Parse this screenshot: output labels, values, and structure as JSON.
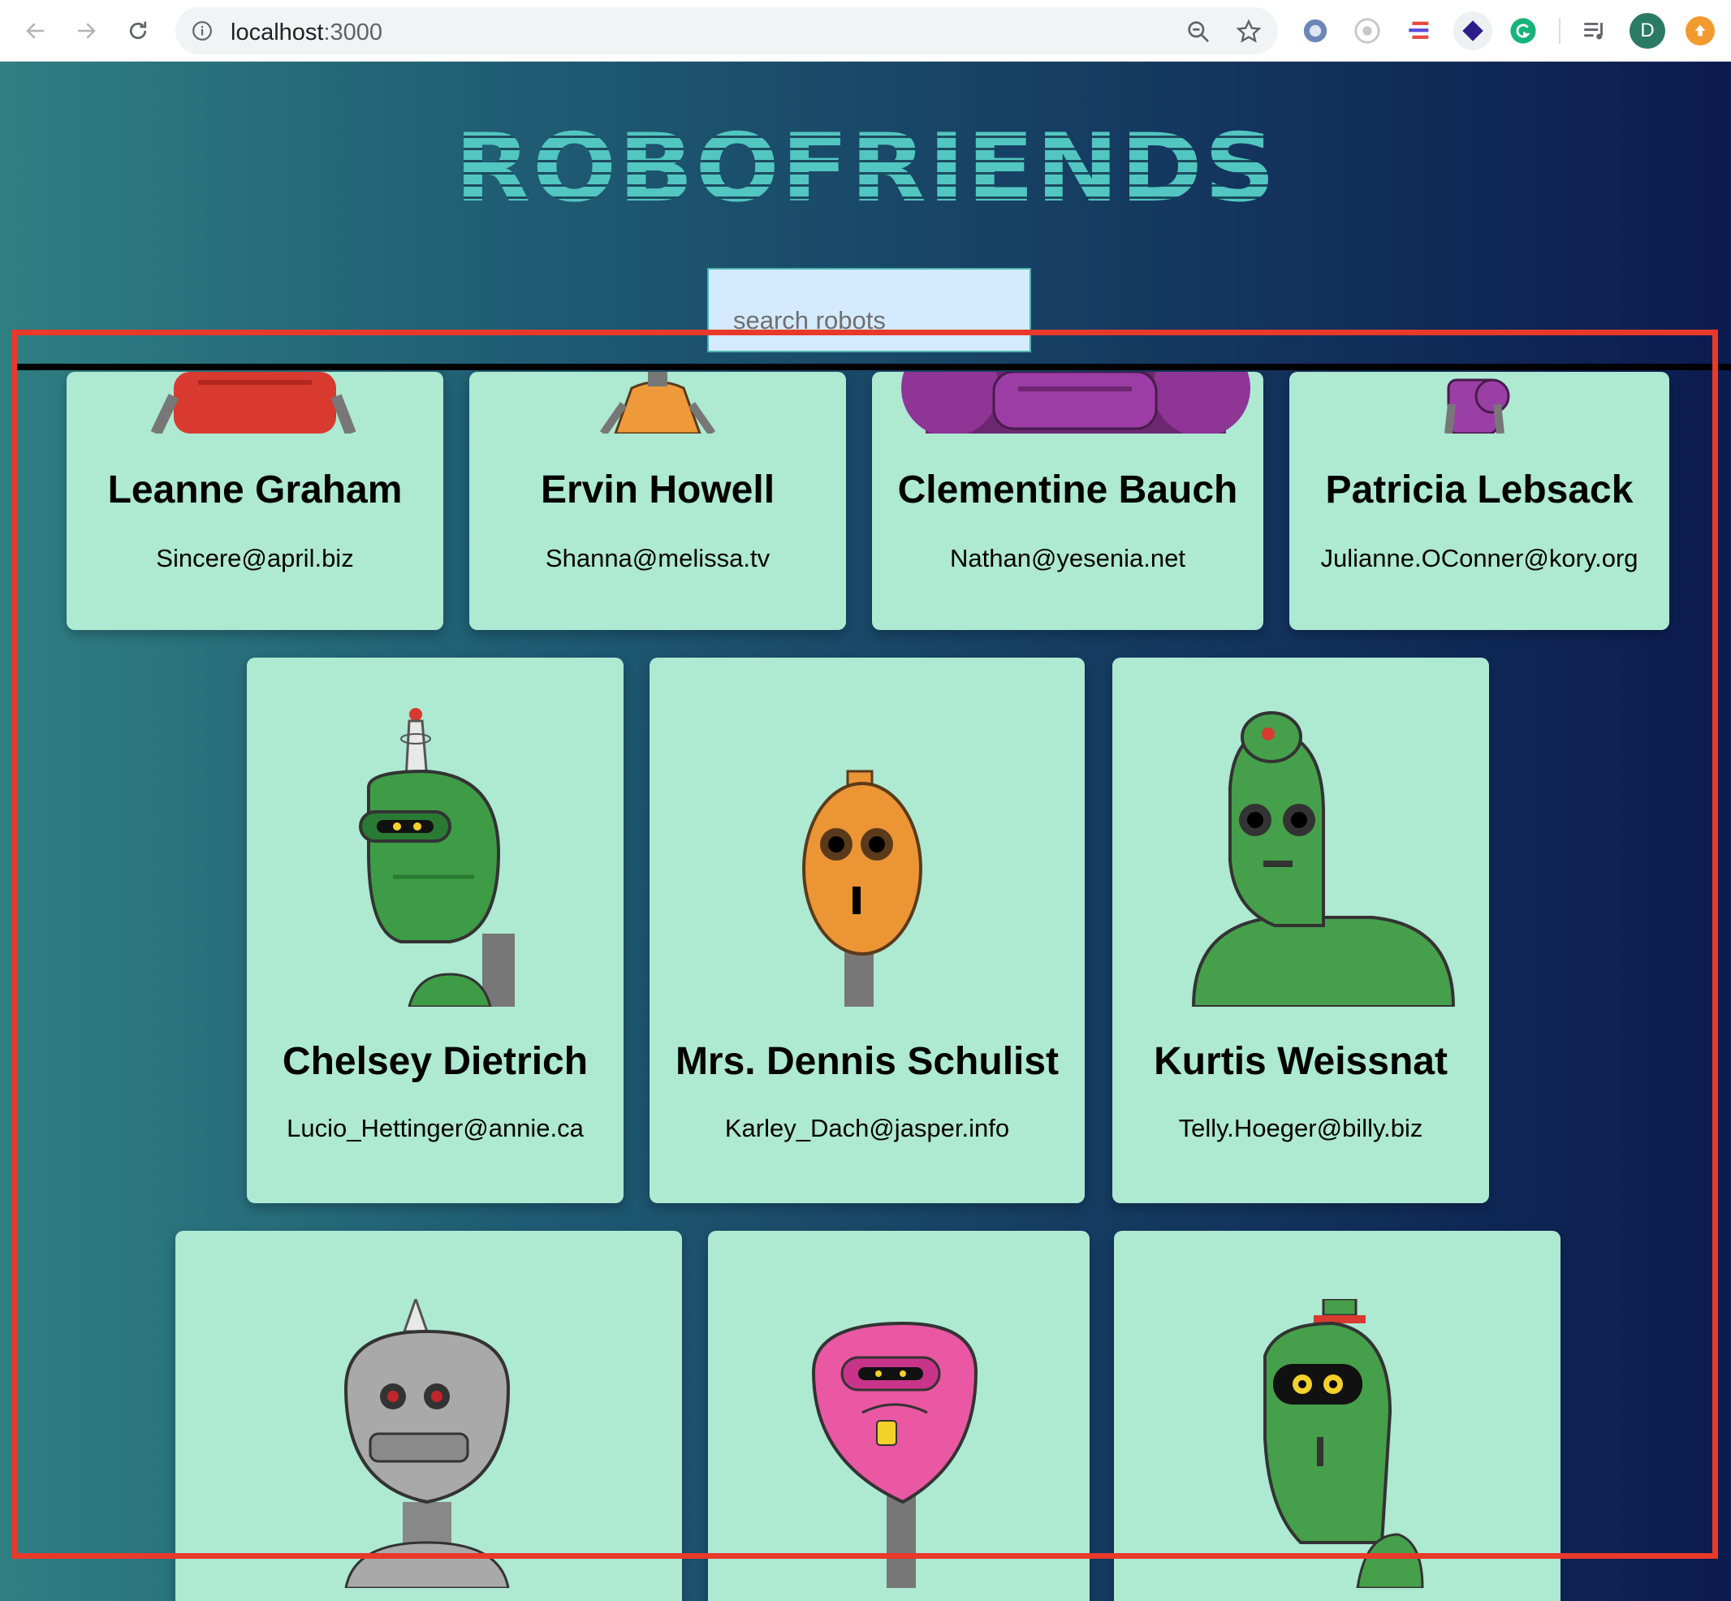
{
  "browser": {
    "url_host": "localhost",
    "url_port": ":3000",
    "avatar_letter": "D"
  },
  "app": {
    "title": "ROBOFRIENDS",
    "search_placeholder": "search robots"
  },
  "robots": [
    {
      "name": "Leanne Graham",
      "email": "Sincere@april.biz",
      "color": "#d83a30"
    },
    {
      "name": "Ervin Howell",
      "email": "Shanna@melissa.tv",
      "color": "#ef9a3a"
    },
    {
      "name": "Clementine Bauch",
      "email": "Nathan@yesenia.net",
      "color": "#8e3596"
    },
    {
      "name": "Patricia Lebsack",
      "email": "Julianne.OConner@kory.org",
      "color": "#9a3fa6"
    },
    {
      "name": "Chelsey Dietrich",
      "email": "Lucio_Hettinger@annie.ca",
      "color": "#3e9c46"
    },
    {
      "name": "Mrs. Dennis Schulist",
      "email": "Karley_Dach@jasper.info",
      "color": "#ec9535"
    },
    {
      "name": "Kurtis Weissnat",
      "email": "Telly.Hoeger@billy.biz",
      "color": "#46a04b"
    },
    {
      "name": "",
      "email": "",
      "color": "#a9a9a9"
    },
    {
      "name": "",
      "email": "",
      "color": "#ea57a3"
    },
    {
      "name": "",
      "email": "",
      "color": "#44a047"
    }
  ]
}
